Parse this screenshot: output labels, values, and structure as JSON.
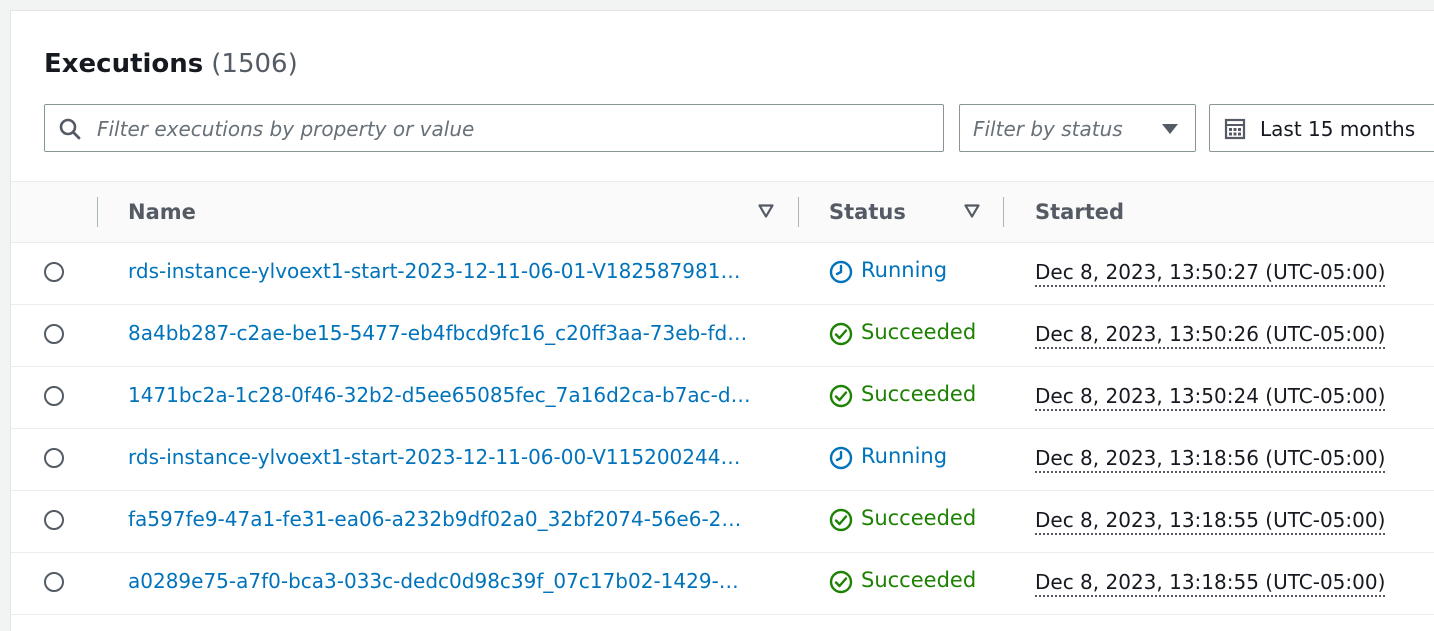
{
  "header": {
    "title": "Executions",
    "count": "(1506)"
  },
  "search": {
    "placeholder": "Filter executions by property or value",
    "value": ""
  },
  "status_filter": {
    "label": "Filter by status"
  },
  "date_filter": {
    "label": "Last 15 months"
  },
  "columns": {
    "name": "Name",
    "status": "Status",
    "started": "Started"
  },
  "colors": {
    "link": "#0073bb",
    "running": "#0073bb",
    "succeeded": "#1d8102"
  },
  "rows": [
    {
      "name": "rds-instance-ylvoext1-start-2023-12-11-06-01-V182587981…",
      "status": "Running",
      "status_icon": "clock-icon",
      "started": "Dec 8, 2023, 13:50:27 (UTC-05:00)"
    },
    {
      "name": "8a4bb287-c2ae-be15-5477-eb4fbcd9fc16_c20ff3aa-73eb-fd…",
      "status": "Succeeded",
      "status_icon": "check-circle-icon",
      "started": "Dec 8, 2023, 13:50:26 (UTC-05:00)"
    },
    {
      "name": "1471bc2a-1c28-0f46-32b2-d5ee65085fec_7a16d2ca-b7ac-d…",
      "status": "Succeeded",
      "status_icon": "check-circle-icon",
      "started": "Dec 8, 2023, 13:50:24 (UTC-05:00)"
    },
    {
      "name": "rds-instance-ylvoext1-start-2023-12-11-06-00-V115200244…",
      "status": "Running",
      "status_icon": "clock-icon",
      "started": "Dec 8, 2023, 13:18:56 (UTC-05:00)"
    },
    {
      "name": "fa597fe9-47a1-fe31-ea06-a232b9df02a0_32bf2074-56e6-2…",
      "status": "Succeeded",
      "status_icon": "check-circle-icon",
      "started": "Dec 8, 2023, 13:18:55 (UTC-05:00)"
    },
    {
      "name": "a0289e75-a7f0-bca3-033c-dedc0d98c39f_07c17b02-1429-…",
      "status": "Succeeded",
      "status_icon": "check-circle-icon",
      "started": "Dec 8, 2023, 13:18:55 (UTC-05:00)"
    }
  ]
}
